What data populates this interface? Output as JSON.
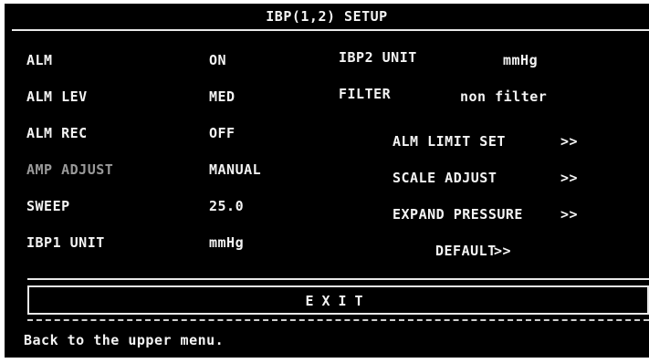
{
  "title": "IBP(1,2) SETUP",
  "left_rows": [
    {
      "label": "ALM",
      "value": "ON"
    },
    {
      "label": "ALM LEV",
      "value": "MED"
    },
    {
      "label": "ALM REC",
      "value": "OFF"
    },
    {
      "label": "AMP ADJUST",
      "value": "MANUAL"
    },
    {
      "label": "SWEEP",
      "value": "25.0"
    },
    {
      "label": "IBP1 UNIT",
      "value": "mmHg"
    }
  ],
  "right_rows": [
    {
      "label": "IBP2 UNIT",
      "value": "mmHg"
    },
    {
      "label": "FILTER",
      "value": "non filter"
    }
  ],
  "menu_items": [
    {
      "label": "ALM LIMIT SET",
      "arrow": ">>"
    },
    {
      "label": "SCALE ADJUST",
      "arrow": ">>"
    },
    {
      "label": "EXPAND PRESSURE",
      "arrow": ">>"
    },
    {
      "label": "DEFAULT",
      "arrow": ">>"
    }
  ],
  "exit_label": "EXIT",
  "status_text": "Back to the upper menu."
}
